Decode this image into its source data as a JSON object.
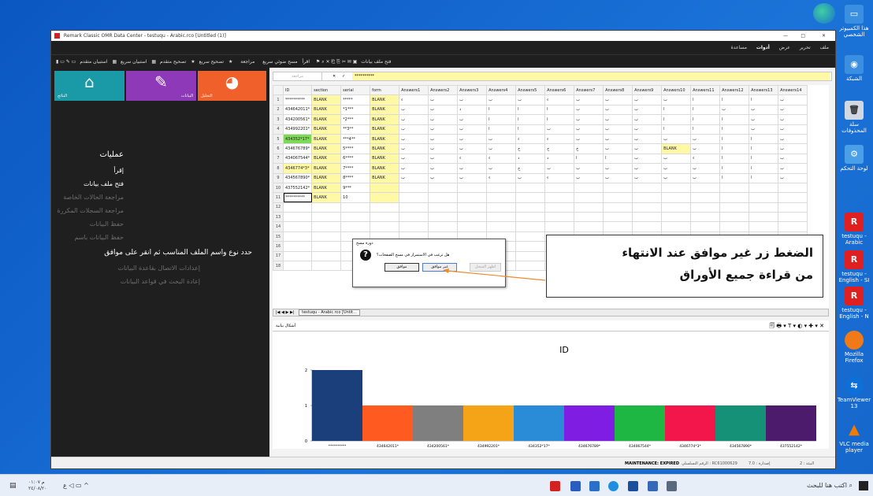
{
  "window": {
    "title": "Remark Classic OMR Data Center - testuqu - Arabic.rco [Untitled (1)]",
    "controls": [
      "—",
      "□",
      "✕"
    ]
  },
  "menu": [
    "ملف",
    "تحرير",
    "عرض",
    "أدوات",
    "مساعدة"
  ],
  "toolbar": {
    "items": [
      "فتح ملف بيانات",
      "اقرأ",
      "مسح ضوئي سريع",
      "مراجعة",
      "تصحيح سريع",
      "تصحيح متقدم",
      "استبيان سريع",
      "استبيان متقدم"
    ]
  },
  "tiles": [
    {
      "label": "النتائج",
      "icon": "home-icon",
      "color": "#1a9aa6"
    },
    {
      "label": "البيانات",
      "icon": "pencil-icon",
      "color": "#8e3ab8"
    },
    {
      "label": "التحليل",
      "icon": "pie-chart-icon",
      "color": "#f0602a"
    }
  ],
  "operations": {
    "heading": "عمليات",
    "items": [
      {
        "label": "إقرأ",
        "enabled": true
      },
      {
        "label": "فتح ملف بيانات",
        "enabled": true
      },
      {
        "label": "مراجعة الحالات الخاصة",
        "enabled": false
      },
      {
        "label": "مراجعة السجلات المكررة",
        "enabled": false
      },
      {
        "label": "حفظ البيانات",
        "enabled": false
      },
      {
        "label": "حفظ البيانات باسم",
        "enabled": false
      }
    ],
    "heading2": "حدد نوع واسم الملف المناسب ثم انقر على موافق",
    "items2": [
      {
        "label": "إعدادات الاتصال بقاعدة البيانات",
        "enabled": false
      },
      {
        "label": "إعادة البحث في قواعد البيانات",
        "enabled": false
      }
    ]
  },
  "formula_bar": {
    "name_box": "مراجعة",
    "value": "**********",
    "cancel": "✕",
    "confirm": "✓"
  },
  "grid": {
    "columns": [
      "ID",
      "section",
      "serial",
      "form",
      "Answers1",
      "Answers2",
      "Answers3",
      "Answers4",
      "Answers5",
      "Answers6",
      "Answers7",
      "Answers8",
      "Answers9",
      "Answers10",
      "Answers11",
      "Answers12",
      "Answers13",
      "Answers14"
    ],
    "rows": [
      [
        "1",
        "**********",
        "BLANK",
        "*****",
        "BLANK",
        "ء",
        "ب",
        "ب",
        "ب",
        "ب",
        "ء",
        "ب",
        "ب",
        "ب",
        "ب",
        "ا",
        "ا",
        "ا",
        "ب"
      ],
      [
        "2",
        "434642011*",
        "BLANK",
        "*1***",
        "BLANK",
        "ب",
        "ب",
        "د",
        "ا",
        "ا",
        "ا",
        "ب",
        "ب",
        "ب",
        "ا",
        "ا",
        "ب",
        "ب",
        "ب"
      ],
      [
        "3",
        "434200561*",
        "BLANK",
        "*2***",
        "BLANK",
        "ب",
        "ب",
        "ب",
        "ا",
        "ا",
        "ا",
        "ب",
        "ب",
        "ب",
        "ا",
        "ا",
        "ا",
        "ب",
        "ب"
      ],
      [
        "4",
        "434992201*",
        "BLANK",
        "**3**",
        "BLANK",
        "ب",
        "ب",
        "ب",
        "ا",
        "ا",
        "ب",
        "ب",
        "ب",
        "ب",
        "ا",
        "ا",
        "ا",
        "ب",
        "ب"
      ],
      [
        "5",
        "434352*17*",
        "BLANK",
        "***4**",
        "BLANK",
        "ب",
        "ب",
        "ب",
        "ب",
        "ء",
        "ء",
        "ب",
        "ب",
        "ب",
        "ب",
        "ب",
        "ا",
        "ا",
        "ب"
      ],
      [
        "6",
        "434676789*",
        "BLANK",
        "5****",
        "BLANK",
        "ب",
        "ب",
        "ب",
        "ب",
        "ج",
        "ج",
        "ج",
        "ب",
        "ب",
        "BLANK",
        "ب",
        "ا",
        "ا",
        "ب"
      ],
      [
        "7",
        "434067544*",
        "BLANK",
        "6****",
        "BLANK",
        "ب",
        "ب",
        "ء",
        "ء",
        "د",
        "د",
        "ا",
        "ا",
        "ب",
        "ب",
        "ء",
        "ا",
        "ا",
        "ب"
      ],
      [
        "8",
        "4346774*3*",
        "BLANK",
        "7****",
        "BLANK",
        "ب",
        "ب",
        "ب",
        "ب",
        "ج",
        "ب",
        "ب",
        "ب",
        "ب",
        "ب",
        "ب",
        "ا",
        "ا",
        "ب"
      ],
      [
        "9",
        "434567890*",
        "BLANK",
        "8****",
        "BLANK",
        "ب",
        "ب",
        "ب",
        "ء",
        "ب",
        "ء",
        "ب",
        "ب",
        "ب",
        "ب",
        "ب",
        "ا",
        "ا",
        "ب"
      ],
      [
        "10",
        "437552142*",
        "BLANK",
        "9***",
        "",
        "",
        "",
        "",
        "",
        "",
        "",
        "",
        "",
        "",
        "",
        "",
        "",
        "",
        ""
      ],
      [
        "11",
        "**********",
        "BLANK",
        "10",
        "",
        "",
        "",
        "",
        "",
        "",
        "",
        "",
        "",
        "",
        "",
        "",
        "",
        "",
        ""
      ],
      [
        "12",
        "",
        "",
        "",
        "",
        "",
        "",
        "",
        "",
        "",
        "",
        "",
        "",
        "",
        "",
        "",
        "",
        "",
        ""
      ],
      [
        "13",
        "",
        "",
        "",
        "",
        "",
        "",
        "",
        "",
        "",
        "",
        "",
        "",
        "",
        "",
        "",
        "",
        "",
        ""
      ],
      [
        "14",
        "",
        "",
        "",
        "",
        "",
        "",
        "",
        "",
        "",
        "",
        "",
        "",
        "",
        "",
        "",
        "",
        "",
        ""
      ],
      [
        "15",
        "",
        "",
        "",
        "",
        "",
        "",
        "",
        "",
        "",
        "",
        "",
        "",
        "",
        "",
        "",
        "",
        "",
        ""
      ],
      [
        "16",
        "",
        "",
        "",
        "",
        "",
        "",
        "",
        "",
        "",
        "",
        "",
        "",
        "",
        "",
        "",
        "",
        "",
        ""
      ],
      [
        "17",
        "",
        "",
        "",
        "",
        "",
        "",
        "",
        "",
        "",
        "",
        "",
        "",
        "",
        "",
        "",
        "",
        "",
        ""
      ],
      [
        "18",
        "",
        "",
        "",
        "",
        "",
        "",
        "",
        "",
        "",
        "",
        "",
        "",
        "",
        "",
        "",
        "",
        "",
        ""
      ]
    ]
  },
  "sheet_tab": "testuqu - Arabic.rco [Untit...",
  "chart_panel": {
    "title": "أشكال بيانية",
    "tools": "🗐 🖶 ▾ T ▾ ◐ ▾ ✚ ▾ ✕"
  },
  "chart_data": {
    "type": "bar",
    "title": "ID",
    "categories": [
      "**********",
      "434642011*",
      "434200561*",
      "434992201*",
      "434352*17*",
      "434676789*",
      "434067544*",
      "4346774*3*",
      "434567890*",
      "437552142*"
    ],
    "values": [
      2,
      1,
      1,
      1,
      1,
      1,
      1,
      1,
      1,
      1
    ],
    "colors": [
      "#1b3f7a",
      "#ff5a1f",
      "#7f7f7f",
      "#f5a418",
      "#2a8bd6",
      "#7f1de3",
      "#1fb743",
      "#f2164b",
      "#159178",
      "#4d1b6b"
    ],
    "ylim": [
      0,
      2
    ],
    "yticks": [
      0,
      1,
      2
    ]
  },
  "dialog": {
    "title": "دورة مسح",
    "message": "هل ترغب في الاستمرار في مسح الصفحات؟",
    "buttons": [
      "موافق",
      "غير موافق",
      "اظهر السجل"
    ]
  },
  "callout": {
    "line1": "الضغط زر غير موافق عند الانتهاء",
    "line2": "من قراءة جميع الأوراق"
  },
  "status": {
    "maintenance": "MAINTENANCE: EXPIRED",
    "serial": "الرقم التسلسلي : RC61000629",
    "version": "إصدارة : 7.0",
    "edition": "البيئة : 2"
  },
  "desktop_icons": [
    "هذا الكمبيوتر الشخصي",
    "الشبكة",
    "سلة المحذوفات",
    "لوحة التحكم",
    "testuqu - Arabic",
    "testuqu - English - SI",
    "testuqu - English - N",
    "Mozilla Firefox",
    "TeamViewer 13",
    "VLC media player"
  ],
  "taskbar": {
    "search": "اكتب هنا للبحث",
    "time": "م ٠١:٠٧",
    "date": "٢٤/٠٨/٢٠"
  }
}
